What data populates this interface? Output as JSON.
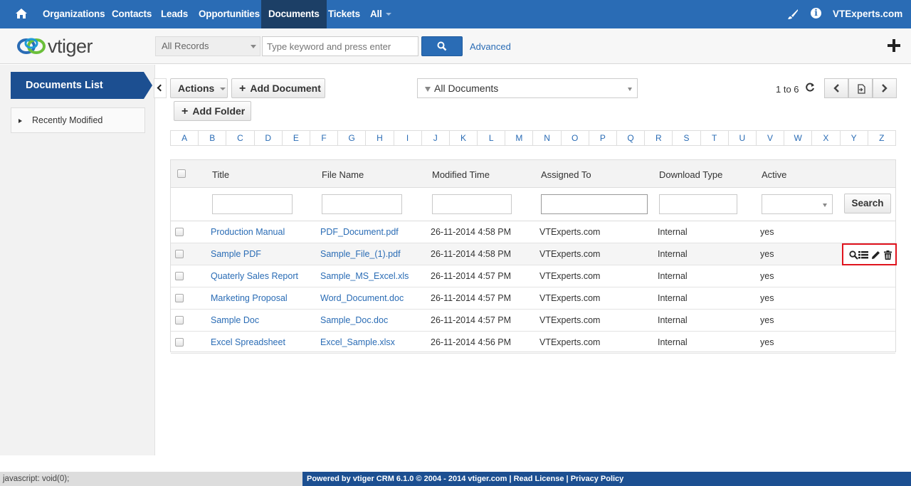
{
  "topnav": {
    "items": [
      "Organizations",
      "Contacts",
      "Leads",
      "Opportunities",
      "Documents",
      "Tickets",
      "All"
    ],
    "active": "Documents",
    "user": "VTExperts.com"
  },
  "logo": {
    "text": "vtiger"
  },
  "search": {
    "record_filter": "All Records",
    "placeholder": "Type keyword and press enter",
    "advanced": "Advanced"
  },
  "sidebar": {
    "title": "Documents List",
    "recent": "Recently Modified"
  },
  "toolbar": {
    "actions": "Actions",
    "add_document": "Add Document",
    "add_folder": "Add Folder",
    "filter": "All Documents",
    "pagination": "1 to 6"
  },
  "alphabet": [
    "A",
    "B",
    "C",
    "D",
    "E",
    "F",
    "G",
    "H",
    "I",
    "J",
    "K",
    "L",
    "M",
    "N",
    "O",
    "P",
    "Q",
    "R",
    "S",
    "T",
    "U",
    "V",
    "W",
    "X",
    "Y",
    "Z"
  ],
  "table": {
    "columns": [
      "Title",
      "File Name",
      "Modified Time",
      "Assigned To",
      "Download Type",
      "Active"
    ],
    "search_label": "Search",
    "rows": [
      {
        "title": "Production Manual",
        "file": "PDF_Document.pdf",
        "modified": "26-11-2014 4:58 PM",
        "assigned": "VTExperts.com",
        "download": "Internal",
        "active": "yes"
      },
      {
        "title": "Sample PDF",
        "file": "Sample_File_(1).pdf",
        "modified": "26-11-2014 4:58 PM",
        "assigned": "VTExperts.com",
        "download": "Internal",
        "active": "yes"
      },
      {
        "title": "Quaterly Sales Report",
        "file": "Sample_MS_Excel.xls",
        "modified": "26-11-2014 4:57 PM",
        "assigned": "VTExperts.com",
        "download": "Internal",
        "active": "yes"
      },
      {
        "title": "Marketing Proposal",
        "file": "Word_Document.doc",
        "modified": "26-11-2014 4:57 PM",
        "assigned": "VTExperts.com",
        "download": "Internal",
        "active": "yes"
      },
      {
        "title": "Sample Doc",
        "file": "Sample_Doc.doc",
        "modified": "26-11-2014 4:57 PM",
        "assigned": "VTExperts.com",
        "download": "Internal",
        "active": "yes"
      },
      {
        "title": "Excel Spreadsheet",
        "file": "Excel_Sample.xlsx",
        "modified": "26-11-2014 4:56 PM",
        "assigned": "VTExperts.com",
        "download": "Internal",
        "active": "yes"
      }
    ],
    "row_icons": [
      "magnifier-icon",
      "list-icon",
      "pencil-icon",
      "trash-icon"
    ]
  },
  "statusbar": {
    "text": "javascript: void(0);"
  },
  "footer": {
    "text": "Powered by vtiger CRM 6.1.0  © 2004 - 2014  vtiger.com | Read License | Privacy Policy"
  },
  "colors": {
    "primary": "#2a6cb5",
    "dark": "#1c4f91",
    "highlight": "#e0141e"
  }
}
